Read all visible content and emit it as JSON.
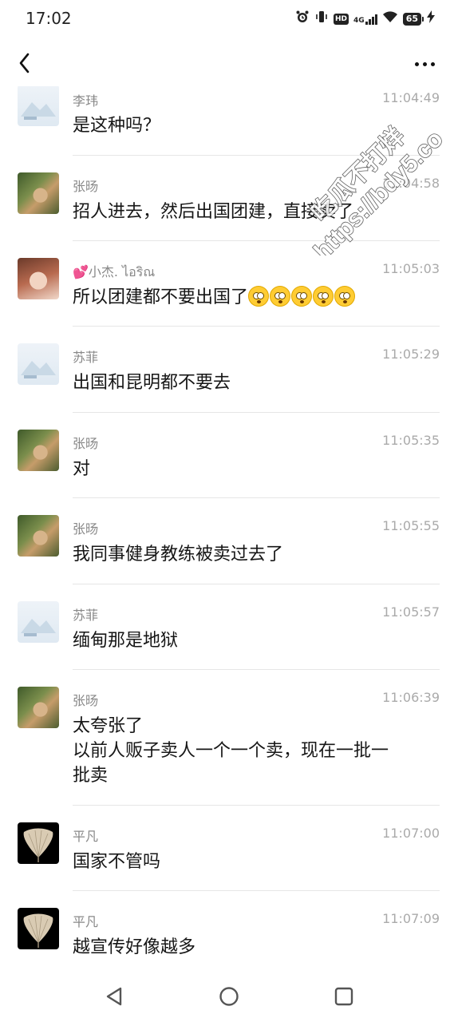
{
  "status_bar": {
    "time": "17:02",
    "hd_label": "HD",
    "network_label": "4G",
    "battery_level": "65"
  },
  "nav_bar": {
    "back_icon": "back-chevron-icon",
    "more_icon": "more-dots-icon"
  },
  "messages": [
    {
      "sender": "李玮",
      "time": "11:04:49",
      "text": "是这种吗？",
      "avatar": "placeholder-image"
    },
    {
      "sender": "张旸",
      "time": "11:04:58",
      "text": "招人进去，然后出国团建，直接卖了",
      "avatar": "photo-outdoor"
    },
    {
      "sender": "💕小杰. ไอริณ",
      "time": "11:05:03",
      "text": "所以团建都不要出国了",
      "emoji_count": 5,
      "avatar": "photo-girl"
    },
    {
      "sender": "苏菲",
      "time": "11:05:29",
      "text": "出国和昆明都不要去",
      "avatar": "placeholder-image"
    },
    {
      "sender": "张旸",
      "time": "11:05:35",
      "text": "对",
      "avatar": "photo-outdoor"
    },
    {
      "sender": "张旸",
      "time": "11:05:55",
      "text": "我同事健身教练被卖过去了",
      "avatar": "photo-outdoor"
    },
    {
      "sender": "苏菲",
      "time": "11:05:57",
      "text": "缅甸那是地狱",
      "avatar": "placeholder-image"
    },
    {
      "sender": "张旸",
      "time": "11:06:39",
      "text_lines": [
        "太夸张了",
        "以前人贩子卖人一个一个卖，现在一批一",
        "批卖"
      ],
      "avatar": "photo-outdoor"
    },
    {
      "sender": "平凡",
      "time": "11:07:00",
      "text": "国家不管吗",
      "avatar": "leaf-photo"
    },
    {
      "sender": "平凡",
      "time": "11:07:09",
      "text": "越宣传好像越多",
      "avatar": "leaf-photo"
    }
  ],
  "watermark": {
    "line1": "吃瓜不打烊",
    "line2": "https://bdy5.co"
  },
  "bottom_nav": {
    "back_icon": "triangle-back-icon",
    "home_icon": "circle-home-icon",
    "recents_icon": "square-recents-icon"
  },
  "colors": {
    "background": "#ffffff",
    "text": "#161616",
    "meta_text": "#888888",
    "divider": "#e6e6e6"
  }
}
